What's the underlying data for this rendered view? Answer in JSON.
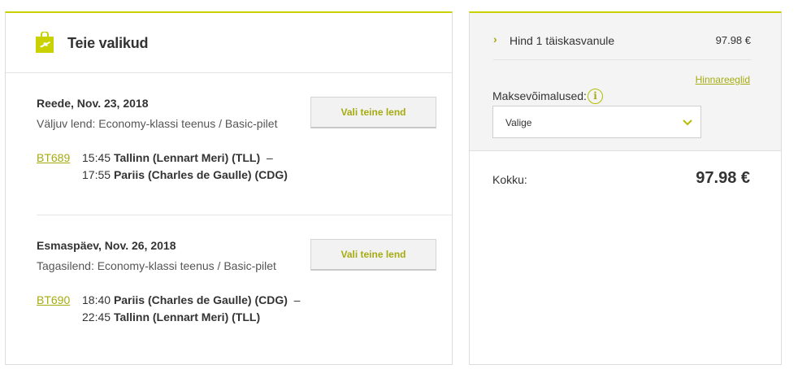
{
  "selection": {
    "title": "Teie valikud",
    "flights": [
      {
        "date": "Reede, Nov. 23, 2018",
        "description": "Väljuv lend: Economy-klassi teenus / Basic-pilet",
        "button_label": "Vali teine lend",
        "flight_code": "BT689",
        "departure_time": "15:45",
        "departure_place": "Tallinn (Lennart Meri) (TLL)",
        "separator": "–",
        "arrival_time": "17:55",
        "arrival_place": "Pariis (Charles de Gaulle) (CDG)"
      },
      {
        "date": "Esmaspäev, Nov. 26, 2018",
        "description": "Tagasilend: Economy-klassi teenus / Basic-pilet",
        "button_label": "Vali teine lend",
        "flight_code": "BT690",
        "departure_time": "18:40",
        "departure_place": "Pariis (Charles de Gaulle) (CDG)",
        "separator": "–",
        "arrival_time": "22:45",
        "arrival_place": "Tallinn (Lennart Meri) (TLL)"
      }
    ]
  },
  "summary": {
    "price_label": "Hind 1 täiskasvanule",
    "price_value": "97.98 €",
    "rules_link": "Hinnareeglid",
    "payment_label": "Maksevõimalused:",
    "payment_select_value": "Valige",
    "total_label": "Kokku:",
    "total_value": "97.98 €"
  },
  "colors": {
    "accent": "#c9d200",
    "link": "#a5ab10",
    "panel_bg": "#f4f4f4"
  },
  "icons": {
    "header": "shopping-bag-plane-icon",
    "expand": "chevron-right-icon",
    "info": "info-icon",
    "select": "chevron-down-icon"
  }
}
